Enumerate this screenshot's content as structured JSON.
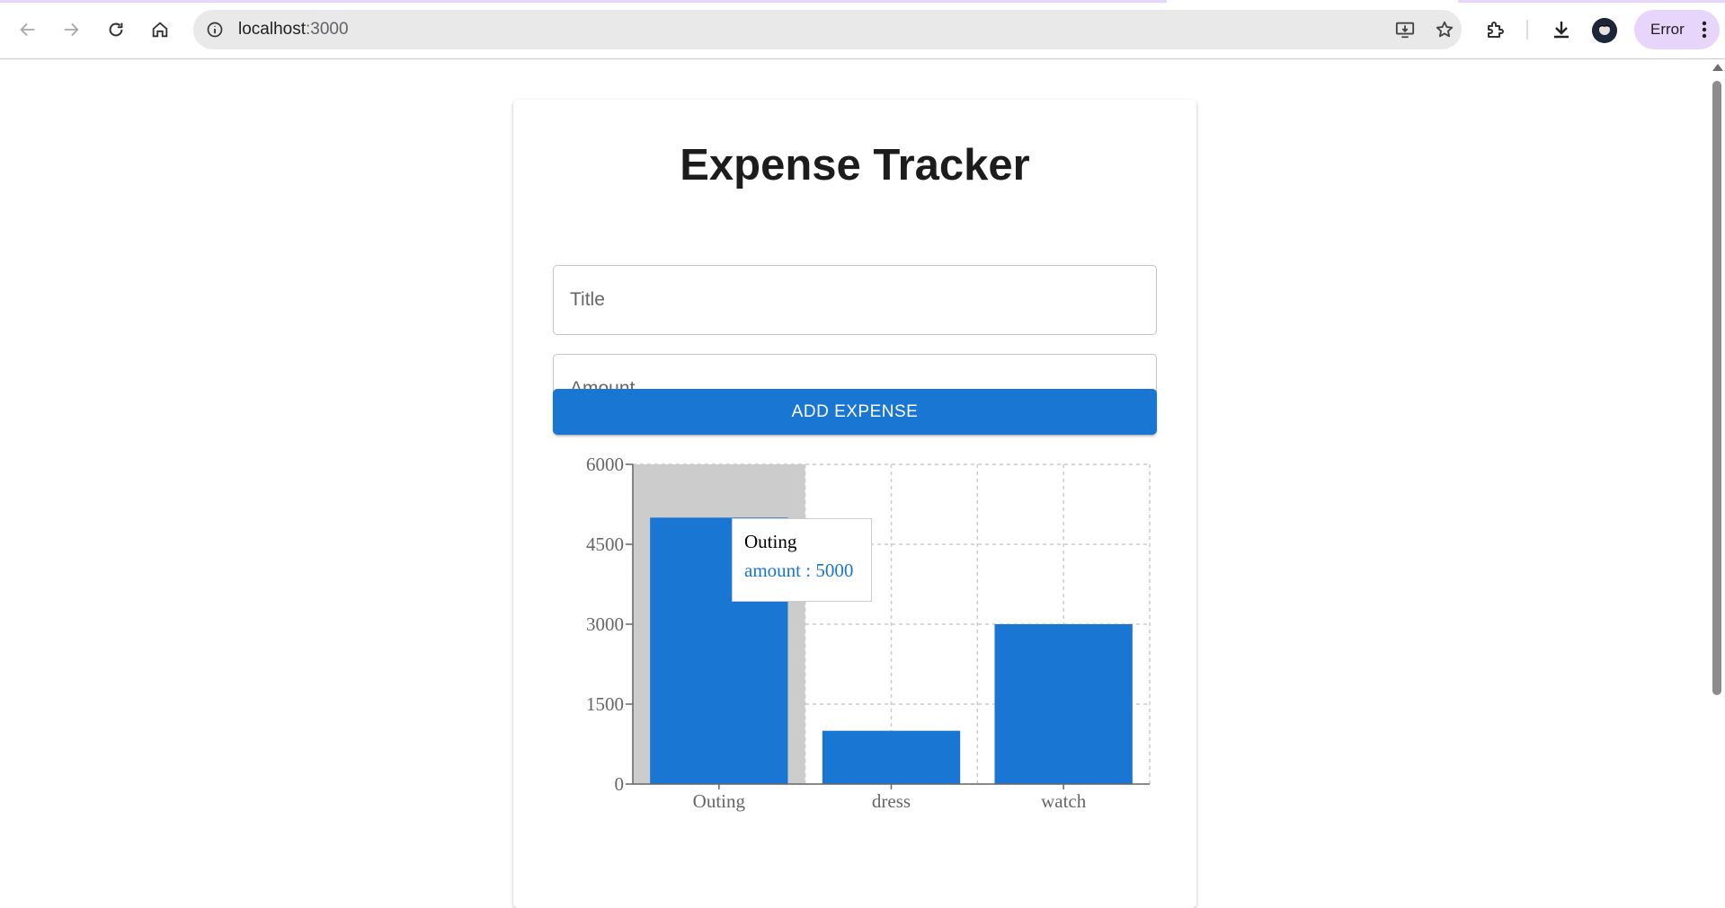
{
  "browser": {
    "url_host": "localhost",
    "url_port": ":3000",
    "profile_status": "Error",
    "icons": [
      "back-arrow-icon",
      "forward-arrow-icon",
      "reload-icon",
      "home-icon",
      "site-info-icon",
      "install-app-icon",
      "bookmark-star-icon",
      "extensions-puzzle-icon",
      "download-icon",
      "menu-dots-icon"
    ]
  },
  "app": {
    "title": "Expense Tracker",
    "title_placeholder": "Title",
    "amount_placeholder": "Amount",
    "add_button_label": "ADD EXPENSE",
    "accent_color": "#1976d2"
  },
  "tooltip": {
    "label": "Outing",
    "value_text": "amount : 5000"
  },
  "chart_data": {
    "type": "bar",
    "categories": [
      "Outing",
      "dress",
      "watch"
    ],
    "series": [
      {
        "name": "amount",
        "values": [
          5000,
          1000,
          3000
        ],
        "color": "#1976d2"
      }
    ],
    "ylim": [
      0,
      6000
    ],
    "yticks": [
      0,
      1500,
      3000,
      4500,
      6000
    ],
    "grid": true,
    "grid_style": "dashed",
    "highlighted_category": "Outing",
    "xlabel": "",
    "ylabel": "",
    "title": ""
  }
}
